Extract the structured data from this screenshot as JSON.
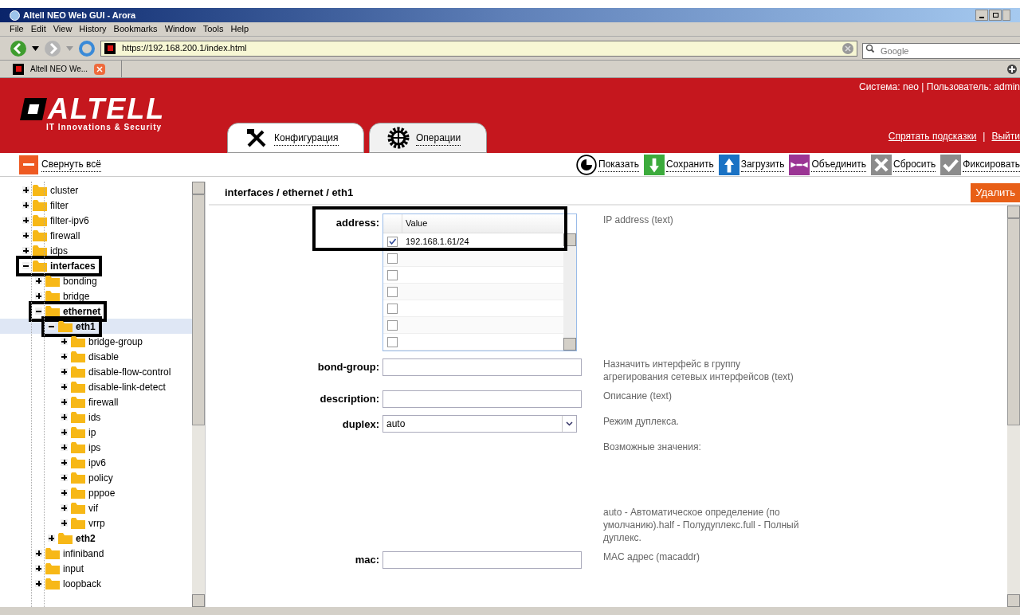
{
  "window": {
    "title": "Altell NEO Web GUI - Arora"
  },
  "menu": [
    "File",
    "Edit",
    "View",
    "History",
    "Bookmarks",
    "Window",
    "Tools",
    "Help"
  ],
  "address_bar": {
    "value": "https://192.168.200.1/index.html"
  },
  "search": {
    "placeholder": "Google"
  },
  "browser_tabs": [
    {
      "label": "Altell NEO We...",
      "selected": true
    }
  ],
  "header": {
    "logo": "ALTELL",
    "tagline": "IT Innovations & Security",
    "system_info": "Система: neo | Пользователь: admin",
    "links": [
      "Спрятать подсказки",
      "Выйти"
    ],
    "link_separator": "|",
    "tabs": [
      {
        "label": "Конфигурация",
        "kind": "tools",
        "selected": true
      },
      {
        "label": "Операции",
        "kind": "gear",
        "selected": false
      }
    ]
  },
  "collapse_all": "Свернуть всё",
  "actions": [
    {
      "label": "Показать",
      "kind": "show",
      "color": "#ffffff"
    },
    {
      "label": "Сохранить",
      "kind": "save",
      "color": "#3cab3c"
    },
    {
      "label": "Загрузить",
      "kind": "load",
      "color": "#1a72c4"
    },
    {
      "label": "Объединить",
      "kind": "merge",
      "color": "#9b3594"
    },
    {
      "label": "Сбросить",
      "kind": "reset",
      "color": "#8c8c8c"
    },
    {
      "label": "Фиксировать",
      "kind": "commit",
      "color": "#8c8c8c"
    }
  ],
  "tree": [
    {
      "label": "cluster",
      "expanded": false,
      "selected": false,
      "emphasized": false,
      "highlighted": false
    },
    {
      "label": "filter",
      "expanded": false,
      "selected": false,
      "emphasized": false,
      "highlighted": false
    },
    {
      "label": "filter-ipv6",
      "expanded": false,
      "selected": false,
      "emphasized": false,
      "highlighted": false
    },
    {
      "label": "firewall",
      "expanded": false,
      "selected": false,
      "emphasized": false,
      "highlighted": false
    },
    {
      "label": "idps",
      "expanded": false,
      "selected": false,
      "emphasized": false,
      "highlighted": false
    },
    {
      "label": "interfaces",
      "expanded": true,
      "selected": false,
      "emphasized": true,
      "highlighted": true,
      "children": [
        {
          "label": "bonding",
          "expanded": false,
          "selected": false,
          "emphasized": false,
          "highlighted": false
        },
        {
          "label": "bridge",
          "expanded": false,
          "selected": false,
          "emphasized": false,
          "highlighted": false
        },
        {
          "label": "ethernet",
          "expanded": true,
          "selected": false,
          "emphasized": true,
          "highlighted": true,
          "children": [
            {
              "label": "eth1",
              "expanded": true,
              "selected": true,
              "emphasized": true,
              "highlighted": true,
              "children": [
                {
                  "label": "bridge-group",
                  "expanded": false,
                  "selected": false,
                  "emphasized": false,
                  "highlighted": false
                },
                {
                  "label": "disable",
                  "expanded": false,
                  "selected": false,
                  "emphasized": false,
                  "highlighted": false
                },
                {
                  "label": "disable-flow-control",
                  "expanded": false,
                  "selected": false,
                  "emphasized": false,
                  "highlighted": false
                },
                {
                  "label": "disable-link-detect",
                  "expanded": false,
                  "selected": false,
                  "emphasized": false,
                  "highlighted": false
                },
                {
                  "label": "firewall",
                  "expanded": false,
                  "selected": false,
                  "emphasized": false,
                  "highlighted": false
                },
                {
                  "label": "ids",
                  "expanded": false,
                  "selected": false,
                  "emphasized": false,
                  "highlighted": false
                },
                {
                  "label": "ip",
                  "expanded": false,
                  "selected": false,
                  "emphasized": false,
                  "highlighted": false
                },
                {
                  "label": "ips",
                  "expanded": false,
                  "selected": false,
                  "emphasized": false,
                  "highlighted": false
                },
                {
                  "label": "ipv6",
                  "expanded": false,
                  "selected": false,
                  "emphasized": false,
                  "highlighted": false
                },
                {
                  "label": "policy",
                  "expanded": false,
                  "selected": false,
                  "emphasized": false,
                  "highlighted": false
                },
                {
                  "label": "pppoe",
                  "expanded": false,
                  "selected": false,
                  "emphasized": false,
                  "highlighted": false
                },
                {
                  "label": "vif",
                  "expanded": false,
                  "selected": false,
                  "emphasized": false,
                  "highlighted": false
                },
                {
                  "label": "vrrp",
                  "expanded": false,
                  "selected": false,
                  "emphasized": false,
                  "highlighted": false
                }
              ]
            },
            {
              "label": "eth2",
              "expanded": false,
              "selected": false,
              "emphasized": true,
              "highlighted": false
            }
          ]
        },
        {
          "label": "infiniband",
          "expanded": false,
          "selected": false,
          "emphasized": false,
          "highlighted": false
        },
        {
          "label": "input",
          "expanded": false,
          "selected": false,
          "emphasized": false,
          "highlighted": false
        },
        {
          "label": "loopback",
          "expanded": false,
          "selected": false,
          "emphasized": false,
          "highlighted": false
        }
      ]
    }
  ],
  "panel": {
    "breadcrumb": "interfaces / ethernet / eth1",
    "delete_button": "Удалить",
    "fields": [
      {
        "label": "address:",
        "kind": "grid",
        "highlighted": true,
        "column": "Value",
        "rows": [
          {
            "value": "192.168.1.61/24",
            "checked": true
          },
          {
            "checked": false
          },
          {
            "checked": false
          },
          {
            "checked": false
          },
          {
            "checked": false
          },
          {
            "checked": false
          },
          {
            "checked": false
          }
        ],
        "hint": [
          "IP address (text)"
        ]
      },
      {
        "label": "bond-group:",
        "kind": "text",
        "hint": [
          "Назначить интерфейс в группу агрегирования сетевых интерфейсов (text)"
        ]
      },
      {
        "label": "description:",
        "kind": "text",
        "hint": [
          "Описание (text)"
        ]
      },
      {
        "label": "duplex:",
        "kind": "select",
        "value": "auto",
        "hint": [
          "Режим дуплекса.",
          "Возможные значения:",
          "auto - Автоматическое определение (по умолчанию).half - Полудуплекс.full - Полный дуплекс."
        ]
      },
      {
        "label": "mac:",
        "kind": "text",
        "hint": [
          "MAC адрес (macaddr)"
        ]
      }
    ]
  }
}
